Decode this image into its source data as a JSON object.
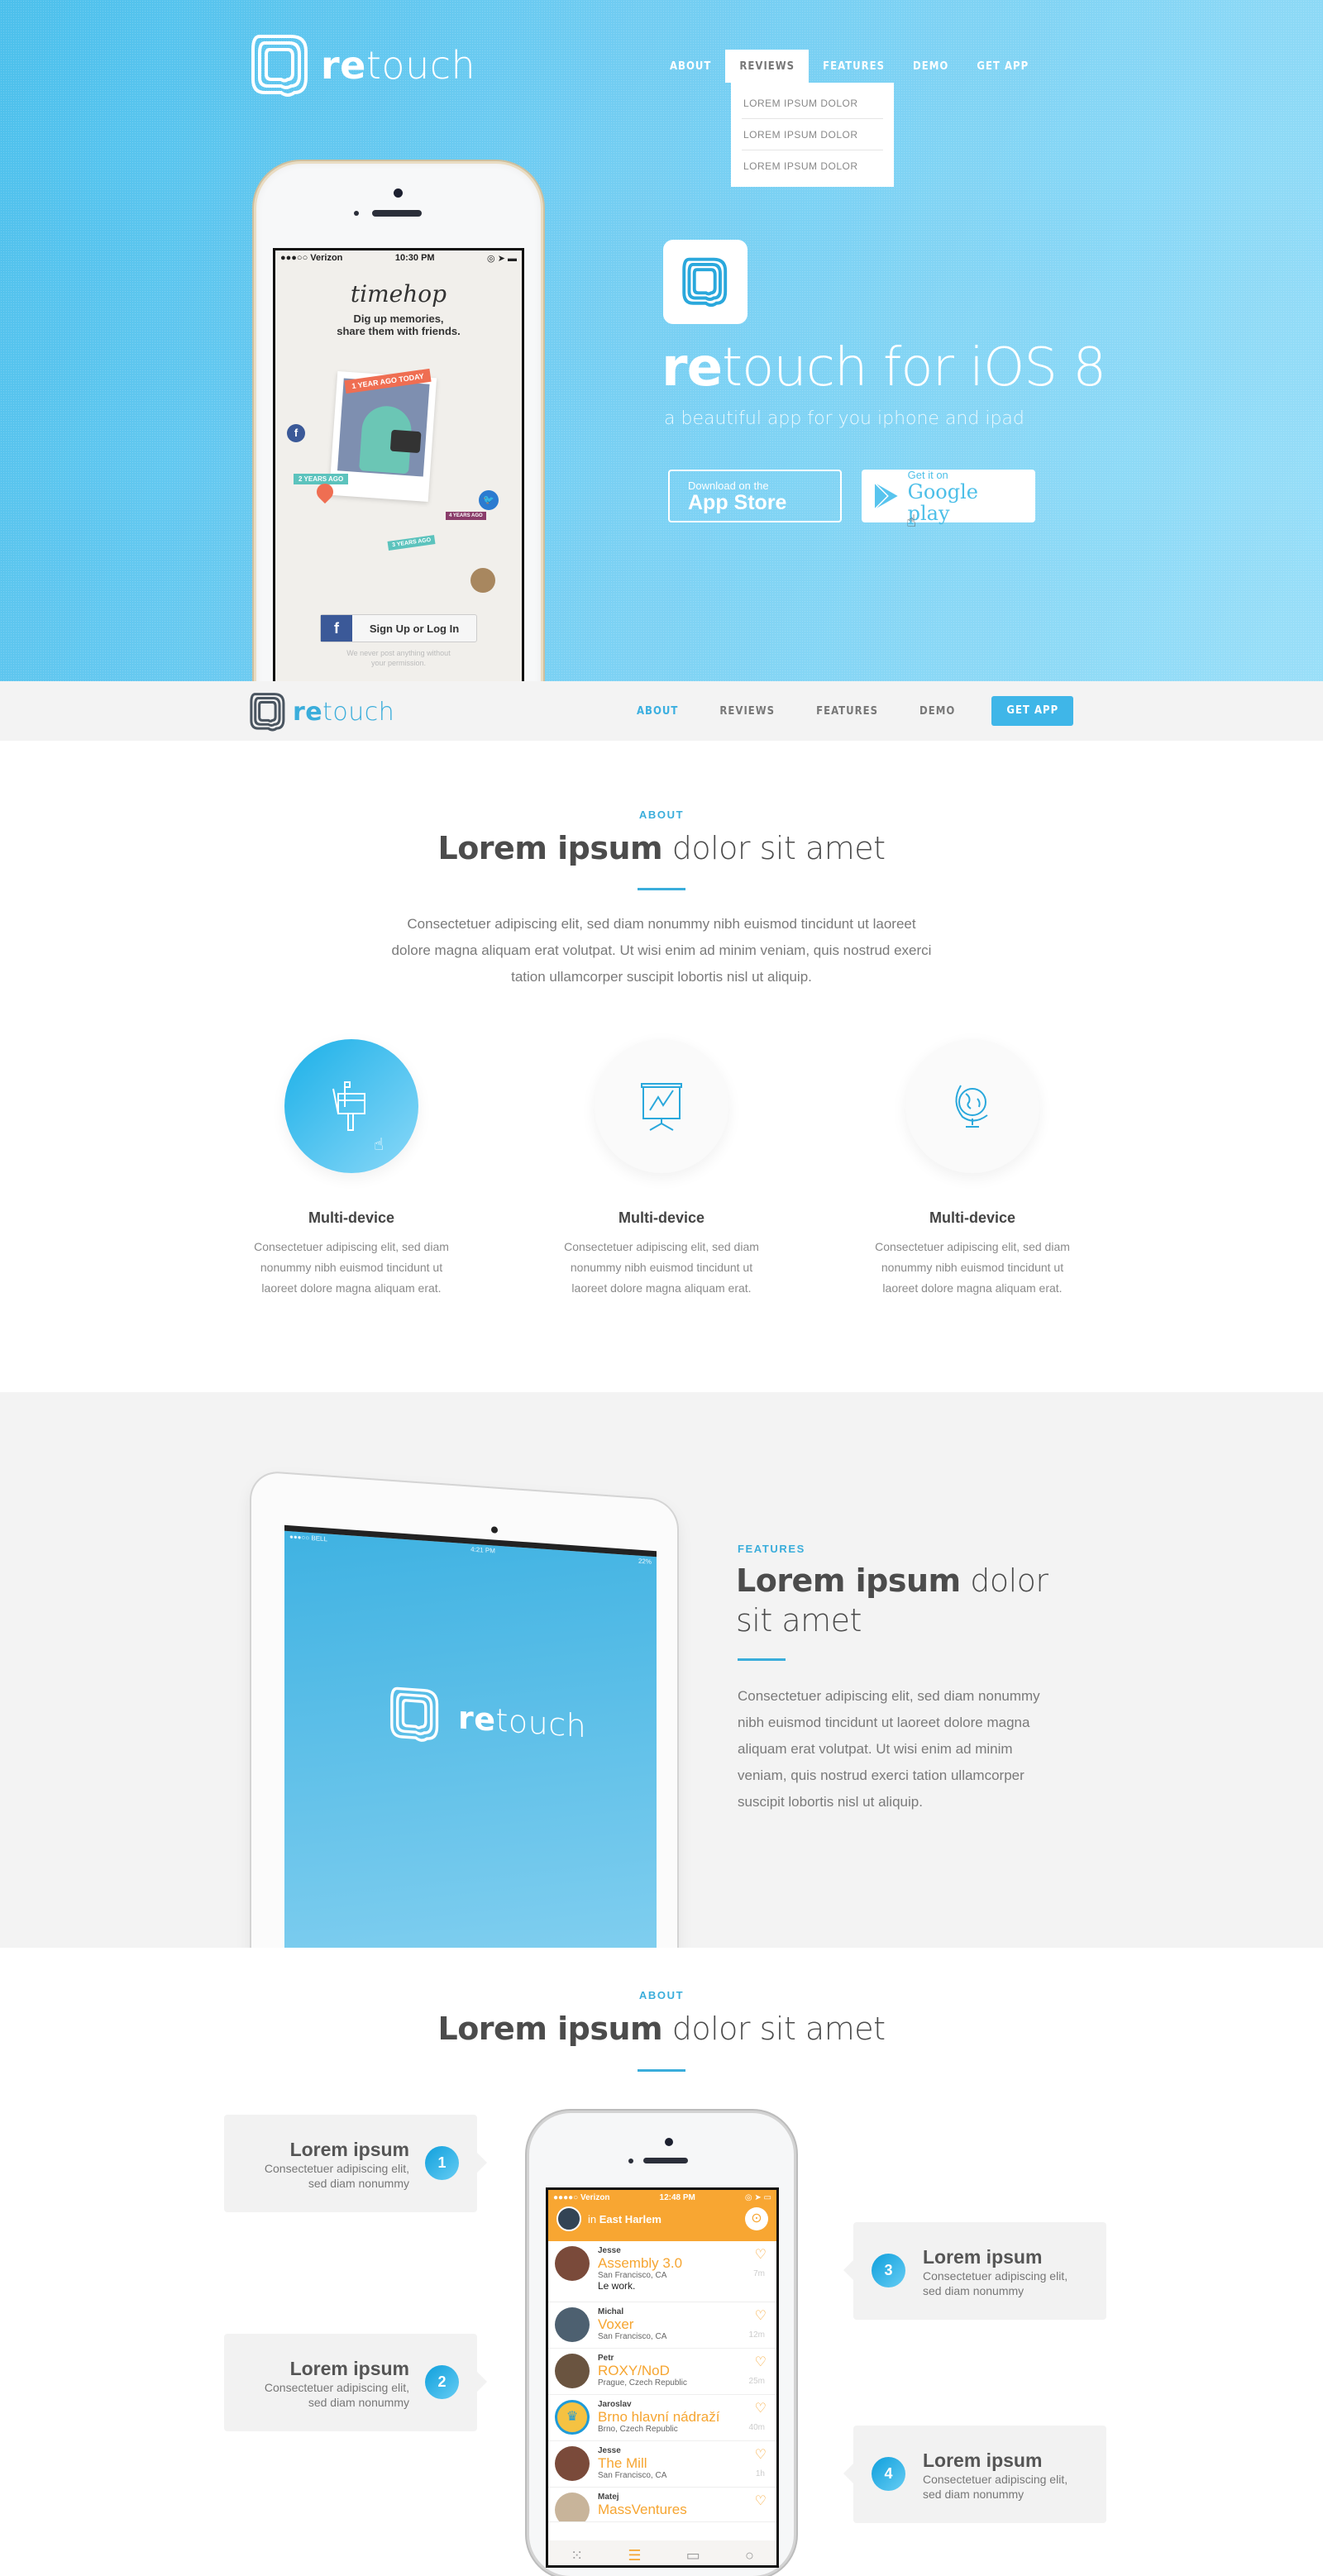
{
  "brand": {
    "prefix": "re",
    "suffix": "touch",
    "tm": "™"
  },
  "topnav": {
    "items": [
      "ABOUT",
      "REVIEWS",
      "FEATURES",
      "DEMO",
      "GET APP"
    ],
    "active_index": 1,
    "dropdown": [
      "LOREM IPSUM DOLOR",
      "LOREM IPSUM DOLOR",
      "LOREM IPSUM DOLOR"
    ]
  },
  "hero": {
    "title_bold": "re",
    "title_rest": "touch for iOS 8",
    "subtitle": "a beautiful app for you iphone and ipad",
    "app_store": {
      "line1": "Download on the",
      "line2": "App Store"
    },
    "google_play": {
      "line1": "Get it on",
      "line2": "Google play"
    },
    "phone": {
      "carrier": "●●●○○ Verizon",
      "time": "10:30 PM",
      "app_name": "timehop",
      "tagline1": "Dig up memories,",
      "tagline2": "share them with friends.",
      "badges": [
        "1 YEAR AGO TODAY",
        "2 YEARS AGO",
        "3 YEARS AGO",
        "4 YEARS AGO"
      ],
      "login_button": "Sign Up or Log In",
      "disclaimer1": "We never post anything without",
      "disclaimer2": "your permission."
    }
  },
  "subnav": {
    "items": [
      "ABOUT",
      "REVIEWS",
      "FEATURES",
      "DEMO"
    ],
    "active_index": 0,
    "cta": "GET APP"
  },
  "about": {
    "kicker": "ABOUT",
    "heading_bold": "Lorem ipsum",
    "heading_rest": " dolor sit amet",
    "body_lines": [
      "Consectetuer adipiscing elit, sed diam nonummy nibh euismod tincidunt ut laoreet",
      "dolore magna aliquam erat volutpat. Ut wisi enim ad minim veniam, quis nostrud exerci",
      "tation ullamcorper suscipit lobortis nisl ut aliquip."
    ],
    "features": [
      {
        "icon": "mailbox-icon",
        "title": "Multi-device",
        "lines": [
          "Consectetuer adipiscing elit, sed diam",
          "nonummy nibh euismod tincidunt ut",
          "laoreet dolore magna aliquam erat."
        ]
      },
      {
        "icon": "presentation-chart-icon",
        "title": "Multi-device",
        "lines": [
          "Consectetuer adipiscing elit, sed diam",
          "nonummy nibh euismod tincidunt ut",
          "laoreet dolore magna aliquam erat."
        ]
      },
      {
        "icon": "globe-icon",
        "title": "Multi-device",
        "lines": [
          "Consectetuer adipiscing elit, sed diam",
          "nonummy nibh euismod tincidunt ut",
          "laoreet dolore magna aliquam erat."
        ]
      }
    ]
  },
  "features_section": {
    "kicker": "FEATURES",
    "heading_bold": "Lorem ipsum",
    "heading_rest1": " dolor",
    "heading_rest2": "sit amet",
    "body_lines": [
      "Consectetuer adipiscing elit, sed diam nonummy",
      "nibh euismod tincidunt ut laoreet dolore magna",
      "aliquam erat volutpat. Ut wisi enim ad minim",
      "veniam, quis nostrud exerci tation ullamcorper",
      "suscipit lobortis nisl ut aliquip."
    ],
    "ipad": {
      "carrier": "●●●○○ BELL",
      "time": "4:21 PM",
      "battery": "22%"
    }
  },
  "steps_section": {
    "kicker": "ABOUT",
    "heading_bold": "Lorem ipsum",
    "heading_rest": " dolor sit amet",
    "steps": [
      {
        "num": "1",
        "title": "Lorem ipsum",
        "line1": "Consectetuer adipiscing elit,",
        "line2": "sed diam nonummy"
      },
      {
        "num": "2",
        "title": "Lorem ipsum",
        "line1": "Consectetuer adipiscing elit,",
        "line2": "sed diam nonummy"
      },
      {
        "num": "3",
        "title": "Lorem ipsum",
        "line1": "Consectetuer adipiscing elit,",
        "line2": "sed diam nonummy"
      },
      {
        "num": "4",
        "title": "Lorem ipsum",
        "line1": "Consectetuer adipiscing elit,",
        "line2": "sed diam nonummy"
      }
    ],
    "phone": {
      "carrier": "●●●●○ Verizon",
      "time": "12:48 PM",
      "location_prefix": "in ",
      "location": "East Harlem",
      "feed": [
        {
          "user": "Jesse",
          "place": "Assembly 3.0",
          "loc": "San Francisco, CA",
          "note": "Le work.",
          "time": "7m"
        },
        {
          "user": "Michal",
          "place": "Voxer",
          "loc": "San Francisco, CA",
          "note": "",
          "time": "12m"
        },
        {
          "user": "Petr",
          "place": "ROXY/NoD",
          "loc": "Prague, Czech Republic",
          "note": "",
          "time": "25m"
        },
        {
          "user": "Jaroslav",
          "place": "Brno hlavní nádraží",
          "loc": "Brno, Czech Republic",
          "note": "",
          "time": "40m"
        },
        {
          "user": "Jesse",
          "place": "The Mill",
          "loc": "San Francisco, CA",
          "note": "",
          "time": "1h"
        },
        {
          "user": "Matej",
          "place": "MassVentures",
          "loc": "",
          "note": "",
          "time": ""
        }
      ]
    }
  },
  "colors": {
    "accent": "#3aaddb",
    "hero_start": "#4cc0ec",
    "hero_end": "#9adff8",
    "grey_bg": "#f3f3f3",
    "orange": "#f6a531"
  }
}
